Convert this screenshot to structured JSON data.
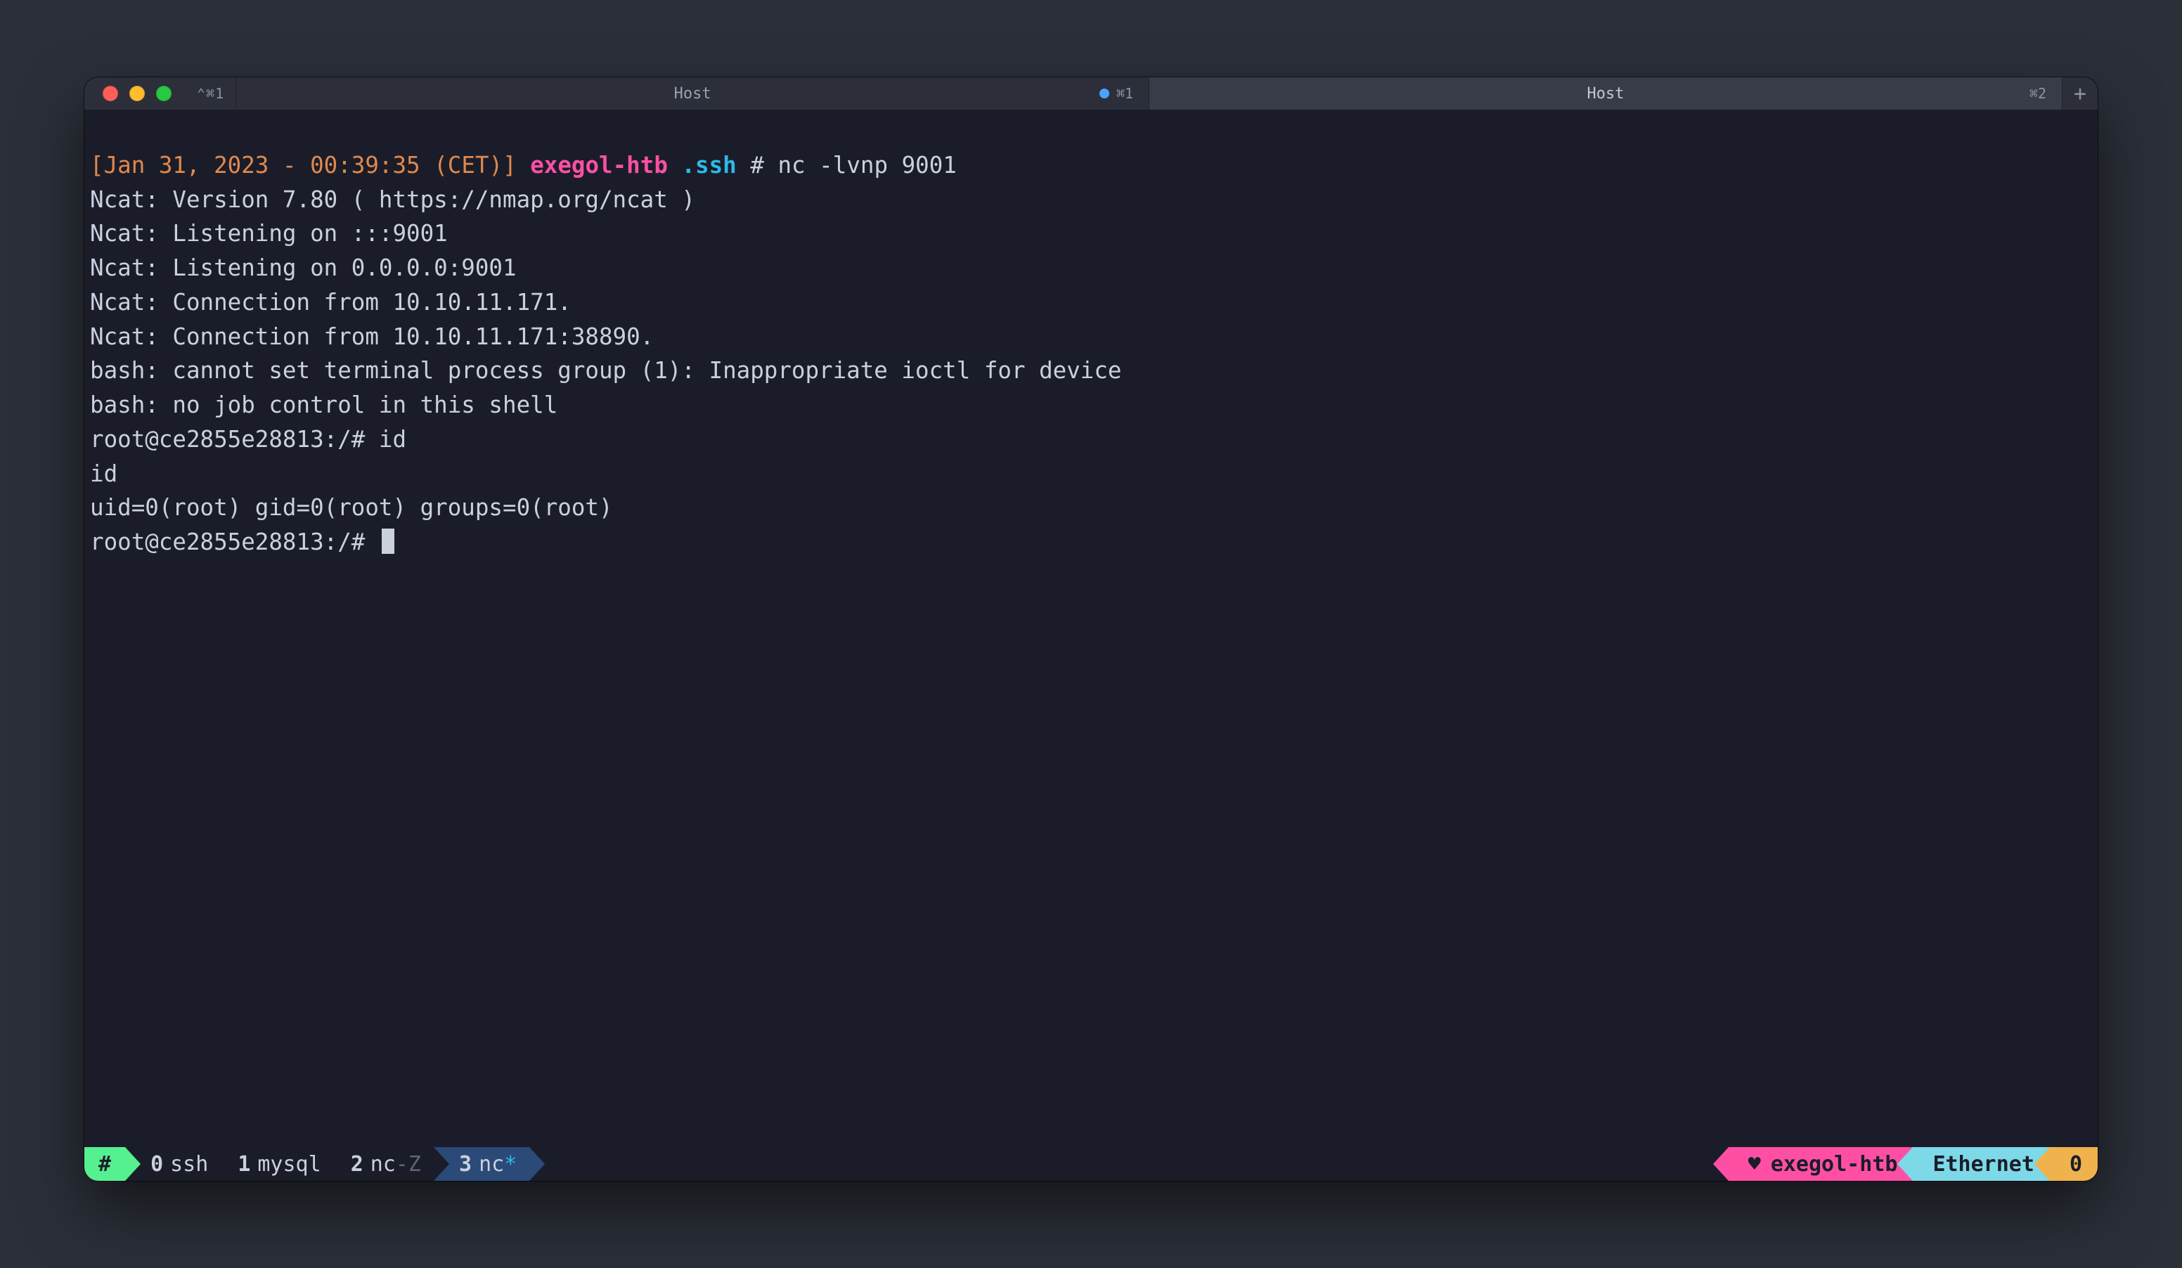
{
  "colors": {
    "bg_page": "#2b2f38",
    "bg_window": "#1a1d29",
    "bg_titlebar": "#2c2f3a",
    "accent_green": "#55f08f",
    "accent_pink": "#ff4fa5",
    "accent_cyan": "#7dd9e8",
    "accent_amber": "#f0b24d",
    "accent_blue_seg": "#2b4a78",
    "text": "#cbd0dd",
    "time_orange": "#e0884d",
    "prompt_pink": "#ff4fa5",
    "prompt_cyan": "#2fb8e8"
  },
  "titlebar": {
    "hint_left": "⌃⌘1",
    "tabs": [
      {
        "title": "Host",
        "shortcut": "⌘1",
        "active": true,
        "modified": true
      },
      {
        "title": "Host",
        "shortcut": "⌘2",
        "active": false,
        "modified": false
      }
    ],
    "add": "+"
  },
  "prompt": {
    "open": "[",
    "date": "Jan 31, 2023",
    "dash": " - ",
    "time": "00:39:35",
    "tz": "(CET)",
    "close": "]",
    "host": "exegol-htb",
    "dir": ".ssh",
    "hash": "#",
    "cmd": "nc -lvnp 9001"
  },
  "output": [
    "Ncat: Version 7.80 ( https://nmap.org/ncat )",
    "Ncat: Listening on :::9001",
    "Ncat: Listening on 0.0.0.0:9001",
    "Ncat: Connection from 10.10.11.171.",
    "Ncat: Connection from 10.10.11.171:38890.",
    "bash: cannot set terminal process group (1): Inappropriate ioctl for device",
    "bash: no job control in this shell",
    "root@ce2855e28813:/# id",
    "id",
    "uid=0(root) gid=0(root) groups=0(root)"
  ],
  "last_prompt": "root@ce2855e28813:/# ",
  "status": {
    "hash": "#",
    "windows": [
      {
        "num": "0",
        "name": "ssh",
        "flag": "",
        "active": false
      },
      {
        "num": "1",
        "name": "mysql",
        "flag": "",
        "active": false
      },
      {
        "num": "2",
        "name": "nc",
        "flag": "-Z",
        "active": false
      },
      {
        "num": "3",
        "name": "nc",
        "flag": "*",
        "active": true
      }
    ],
    "session": "exegol-htb",
    "iface": "Ethernet",
    "right_num": "0",
    "heart": "♥"
  }
}
